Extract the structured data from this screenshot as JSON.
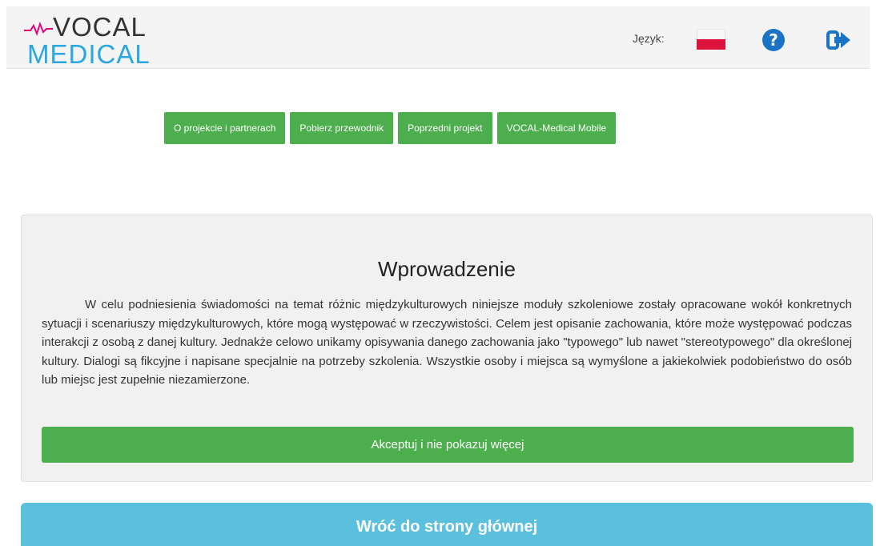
{
  "header": {
    "logo": {
      "line1": "VOCAL",
      "line2": "MEDICAL"
    },
    "language_label": "Język:",
    "language_flag": "flag-poland-icon",
    "help_icon": "question-circle-icon",
    "logout_icon": "sign-out-icon"
  },
  "nav": {
    "items": [
      {
        "label": "O projekcie i partnerach"
      },
      {
        "label": "Pobierz przewodnik"
      },
      {
        "label": "Poprzedni projekt"
      },
      {
        "label": "VOCAL-Medical Mobile"
      }
    ]
  },
  "intro": {
    "title": "Wprowadzenie",
    "text": "W celu podniesienia świadomości na temat różnic międzykulturowych niniejsze moduły szkoleniowe zostały opracowane wokół konkretnych sytuacji i scenariuszy międzykulturowych, które mogą występować w rzeczywistości. Celem jest opisanie zachowania, które może występować podczas interakcji z osobą z danej kultury. Jednakże celowo unikamy opisywania danego zachowania jako \"typowego\" lub nawet \"stereotypowego\" dla określonej kultury. Dialogi są fikcyjne i napisane specjalnie na potrzeby szkolenia. Wszystkie osoby i miejsca są wymyślone a jakiekolwiek podobieństwo do osób lub miejsc jest zupełnie niezamierzone.",
    "accept_label": "Akceptuj i nie pokazuj więcej"
  },
  "footer": {
    "return_label": "Wróć do strony głównej"
  },
  "colors": {
    "green": "#4cae4c",
    "blue": "#5bc0de",
    "logo_blue": "#2aa7df",
    "logo_pink": "#e5007e",
    "help_blue": "#1b73c5"
  }
}
